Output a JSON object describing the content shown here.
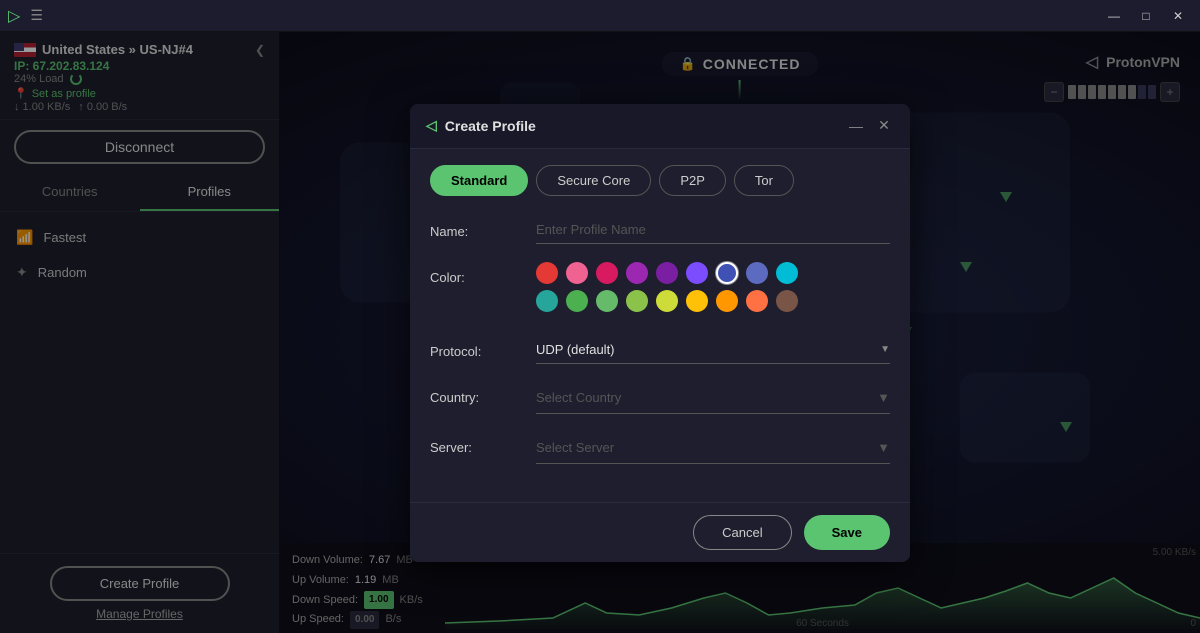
{
  "titleBar": {
    "minimize": "—",
    "maximize": "□",
    "close": "✕"
  },
  "sidebar": {
    "country": "United States » US-NJ#4",
    "ip": "IP: 67.202.83.124",
    "load": "24% Load",
    "setProfile": "Set as profile",
    "speedDown": "↓ 1.00 KB/s",
    "speedUp": "↑ 0.00 B/s",
    "disconnectLabel": "Disconnect",
    "tabs": [
      {
        "label": "Countries",
        "active": false
      },
      {
        "label": "Profiles",
        "active": true
      }
    ],
    "items": [
      {
        "label": "Fastest",
        "icon": "📶"
      },
      {
        "label": "Random",
        "icon": "🔀"
      }
    ],
    "createProfileBtn": "Create Profile",
    "manageProfilesLink": "Manage Profiles"
  },
  "map": {
    "connectedText": "CONNECTED",
    "brandName": "ProtonVPN",
    "speedLabel": "5.00 KB/s",
    "label60s": "60 Seconds",
    "label0": "0"
  },
  "stats": {
    "downVolLabel": "Down Volume:",
    "downVolVal": "7.67",
    "downVolUnit": "MB",
    "upVolLabel": "Up Volume:",
    "upVolVal": "1.19",
    "upVolUnit": "MB",
    "downSpeedLabel": "Down Speed:",
    "downSpeedVal": "1.00",
    "downSpeedUnit": "KB/s",
    "upSpeedLabel": "Up Speed:",
    "upSpeedVal": "0.00",
    "upSpeedUnit": "B/s"
  },
  "modal": {
    "title": "Create Profile",
    "tabs": [
      {
        "label": "Standard",
        "active": true
      },
      {
        "label": "Secure Core",
        "active": false
      },
      {
        "label": "P2P",
        "active": false
      },
      {
        "label": "Tor",
        "active": false
      }
    ],
    "fields": {
      "nameLabel": "Name:",
      "namePlaceholder": "Enter Profile Name",
      "colorLabel": "Color:",
      "protocolLabel": "Protocol:",
      "protocolValue": "UDP (default)",
      "countryLabel": "Country:",
      "countryPlaceholder": "Select Country",
      "serverLabel": "Server:",
      "serverPlaceholder": "Select Server"
    },
    "colors": [
      {
        "hex": "#e53935",
        "selected": false
      },
      {
        "hex": "#f06292",
        "selected": false
      },
      {
        "hex": "#d81b60",
        "selected": false
      },
      {
        "hex": "#9c27b0",
        "selected": false
      },
      {
        "hex": "#7b1fa2",
        "selected": false
      },
      {
        "hex": "#7c4dff",
        "selected": false
      },
      {
        "hex": "#3f51b5",
        "selected": true
      },
      {
        "hex": "#5c6bc0",
        "selected": false
      },
      {
        "hex": "#00bcd4",
        "selected": false
      },
      {
        "hex": "#26a69a",
        "selected": false
      },
      {
        "hex": "#4caf50",
        "selected": false
      },
      {
        "hex": "#66bb6a",
        "selected": false
      },
      {
        "hex": "#8bc34a",
        "selected": false
      },
      {
        "hex": "#cddc39",
        "selected": false
      },
      {
        "hex": "#ffc107",
        "selected": false
      },
      {
        "hex": "#ff9800",
        "selected": false
      },
      {
        "hex": "#ff7043",
        "selected": false
      },
      {
        "hex": "#795548",
        "selected": false
      }
    ],
    "cancelBtn": "Cancel",
    "saveBtn": "Save"
  }
}
